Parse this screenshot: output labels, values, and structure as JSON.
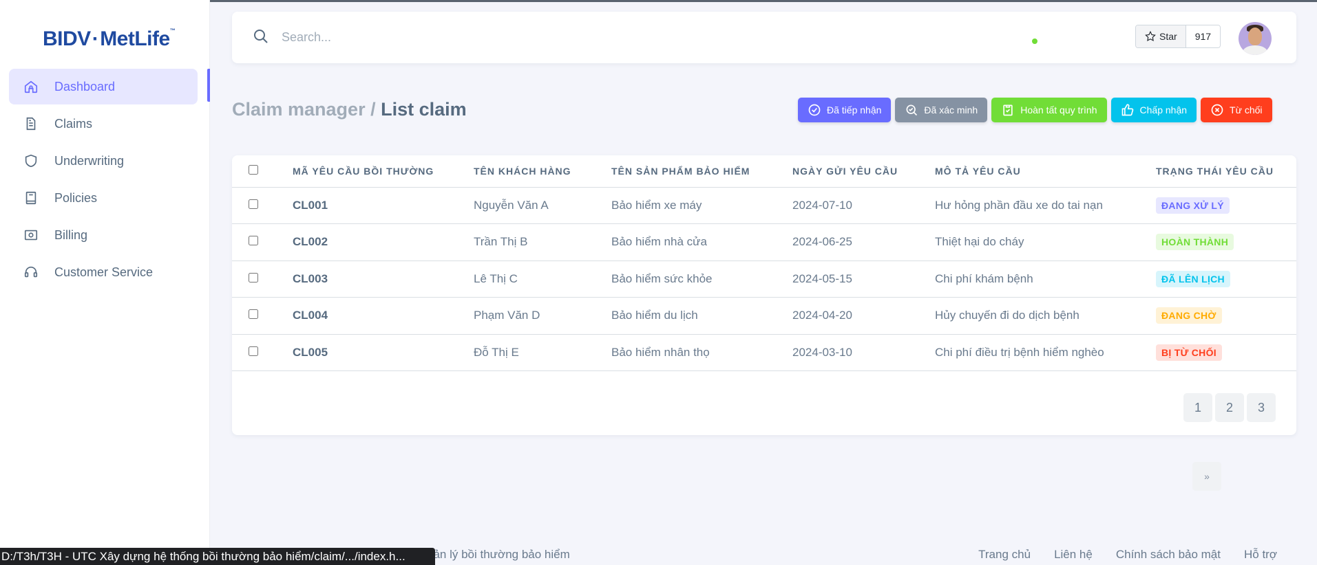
{
  "brand": {
    "logo_text_1": "BIDV",
    "logo_sep": "·",
    "logo_text_2": "MetLife",
    "logo_tm": "™"
  },
  "sidebar": {
    "items": [
      {
        "label": "Dashboard",
        "icon": "home-icon",
        "active": true
      },
      {
        "label": "Claims",
        "icon": "document-icon"
      },
      {
        "label": "Underwriting",
        "icon": "shield-icon"
      },
      {
        "label": "Policies",
        "icon": "book-icon"
      },
      {
        "label": "Billing",
        "icon": "camera-money-icon"
      },
      {
        "label": "Customer Service",
        "icon": "headset-icon"
      }
    ]
  },
  "topbar": {
    "search_placeholder": "Search...",
    "star_label": "Star",
    "star_count": "917"
  },
  "header": {
    "breadcrumb_parent": "Claim manager / ",
    "breadcrumb_current": "List claim"
  },
  "actions": [
    {
      "label": "Đã tiếp nhận",
      "icon": "check-circle-icon",
      "color": "#696cff"
    },
    {
      "label": "Đã xác minh",
      "icon": "search-check-icon",
      "color": "#8592a3"
    },
    {
      "label": "Hoàn tất quy trình",
      "icon": "clipboard-check-icon",
      "color": "#71dd37"
    },
    {
      "label": "Chấp nhận",
      "icon": "thumbs-up-icon",
      "color": "#03c3ec"
    },
    {
      "label": "Từ chối",
      "icon": "x-circle-icon",
      "color": "#ff3e1d"
    }
  ],
  "table": {
    "columns": [
      "MÃ YÊU CẦU BỒI THƯỜNG",
      "TÊN KHÁCH HÀNG",
      "TÊN SẢN PHẨM BẢO HIỂM",
      "NGÀY GỬI YÊU CẦU",
      "MÔ TẢ YÊU CẦU",
      "TRẠNG THÁI YÊU CẦU"
    ],
    "rows": [
      {
        "code": "CL001",
        "customer": "Nguyễn Văn A",
        "product": "Bảo hiểm xe máy",
        "date": "2024-07-10",
        "desc": "Hư hỏng phần đầu xe do tai nạn",
        "status": "ĐANG XỬ LÝ"
      },
      {
        "code": "CL002",
        "customer": "Trần Thị B",
        "product": "Bảo hiểm nhà cửa",
        "date": "2024-06-25",
        "desc": "Thiệt hại do cháy",
        "status": "HOÀN THÀNH"
      },
      {
        "code": "CL003",
        "customer": "Lê Thị C",
        "product": "Bảo hiểm sức khỏe",
        "date": "2024-05-15",
        "desc": "Chi phí khám bệnh",
        "status": "ĐÃ LÊN LỊCH"
      },
      {
        "code": "CL004",
        "customer": "Phạm Văn D",
        "product": "Bảo hiểm du lịch",
        "date": "2024-04-20",
        "desc": "Hủy chuyến đi do dịch bệnh",
        "status": "ĐANG CHỜ"
      },
      {
        "code": "CL005",
        "customer": "Đỗ Thị E",
        "product": "Bảo hiểm nhân thọ",
        "date": "2024-03-10",
        "desc": "Chi phí điều trị bệnh hiểm nghèo",
        "status": "BỊ TỪ CHỐI"
      }
    ]
  },
  "pagination": {
    "prev": "«",
    "pages": [
      "1",
      "2",
      "3"
    ],
    "next": "»"
  },
  "footer": {
    "left_text": "uản lý bồi thường bảo hiểm",
    "links": [
      "Trang chủ",
      "Liên hệ",
      "Chính sách bảo mật",
      "Hỗ trợ"
    ]
  },
  "statusbar": {
    "text": "D:/T3h/T3H - UTC Xây dựng hệ thống bồi thường bảo hiểm/claim/.../index.h..."
  }
}
